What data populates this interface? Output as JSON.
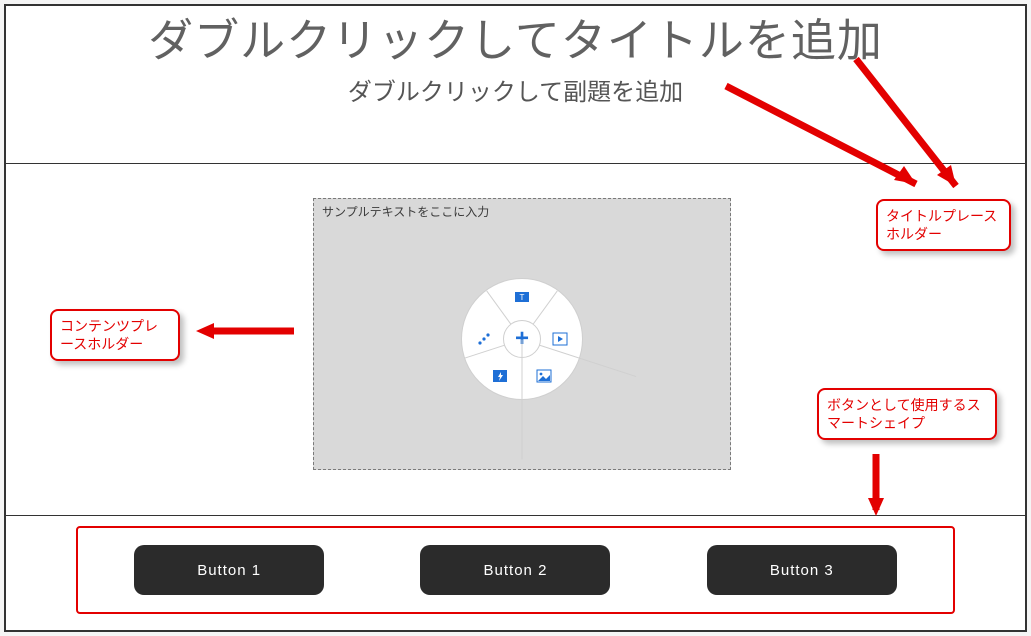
{
  "title": {
    "main": "ダブルクリックしてタイトルを追加",
    "sub": "ダブルクリックして副題を追加"
  },
  "content_placeholder": {
    "hint": "サンプルテキストをここに入力",
    "hub_glyph": "+",
    "segments": {
      "top": "text-caption",
      "right": "media",
      "left": "chart",
      "bottom_left": "flash",
      "bottom_right": "image"
    }
  },
  "callouts": {
    "content": "コンテンツプレースホルダー",
    "title": "タイトルプレースホルダー",
    "smartshape": "ボタンとして使用するスマートシェイプ"
  },
  "buttons": {
    "b1": "Button 1",
    "b2": "Button 2",
    "b3": "Button 3"
  },
  "colors": {
    "annotation": "#e30000",
    "button_bg": "#2b2b2b",
    "accent": "#1e6fd6"
  }
}
